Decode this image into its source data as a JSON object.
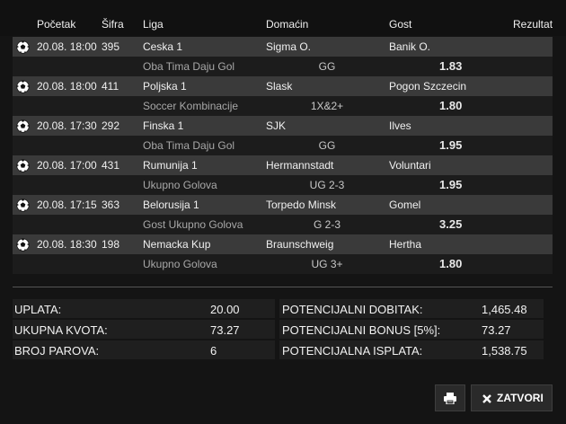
{
  "header": {
    "start": "Početak",
    "code": "Šifra",
    "league": "Liga",
    "home": "Domaćin",
    "away": "Gost",
    "result": "Rezultat"
  },
  "matches": [
    {
      "start": "20.08. 18:00",
      "code": "395",
      "league": "Ceska 1",
      "home": "Sigma O.",
      "away": "Banik O.",
      "bet_type": "Oba Tima Daju Gol",
      "tip": "GG",
      "odd": "1.83"
    },
    {
      "start": "20.08. 18:00",
      "code": "411",
      "league": "Poljska 1",
      "home": "Slask",
      "away": "Pogon Szczecin",
      "bet_type": "Soccer Kombinacije",
      "tip": "1X&2+",
      "odd": "1.80"
    },
    {
      "start": "20.08. 17:30",
      "code": "292",
      "league": "Finska 1",
      "home": "SJK",
      "away": "Ilves",
      "bet_type": "Oba Tima Daju Gol",
      "tip": "GG",
      "odd": "1.95"
    },
    {
      "start": "20.08. 17:00",
      "code": "431",
      "league": "Rumunija 1",
      "home": "Hermannstadt",
      "away": "Voluntari",
      "bet_type": "Ukupno Golova",
      "tip": "UG 2-3",
      "odd": "1.95"
    },
    {
      "start": "20.08. 17:15",
      "code": "363",
      "league": "Belorusija 1",
      "home": "Torpedo Minsk",
      "away": "Gomel",
      "bet_type": "Gost Ukupno Golova",
      "tip": "G 2-3",
      "odd": "3.25"
    },
    {
      "start": "20.08. 18:30",
      "code": "198",
      "league": "Nemacka Kup",
      "home": "Braunschweig",
      "away": "Hertha",
      "bet_type": "Ukupno Golova",
      "tip": "UG 3+",
      "odd": "1.80"
    }
  ],
  "summary_left": [
    {
      "label": "UPLATA:",
      "value": "20.00"
    },
    {
      "label": "UKUPNA KVOTA:",
      "value": "73.27"
    },
    {
      "label": "BROJ PAROVA:",
      "value": "6"
    }
  ],
  "summary_right": [
    {
      "label": "POTENCIJALNI DOBITAK:",
      "value": "1,465.48"
    },
    {
      "label": "POTENCIJALNI BONUS [5%]:",
      "value": "73.27"
    },
    {
      "label": "POTENCIJALNA ISPLATA:",
      "value": "1,538.75"
    }
  ],
  "buttons": {
    "print_icon": "printer-icon",
    "close_icon": "close-icon",
    "close_label": "ZATVORI"
  }
}
